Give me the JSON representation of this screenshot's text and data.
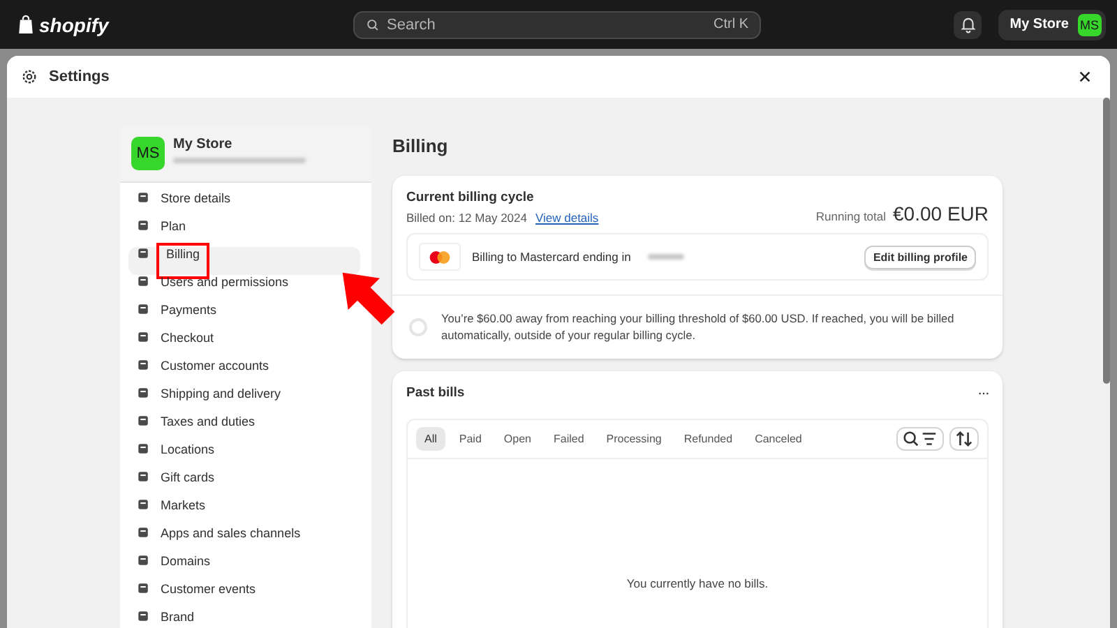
{
  "topbar": {
    "logo": "shopify",
    "search": {
      "placeholder": "Search",
      "shortcut": "Ctrl K"
    },
    "store_button": "My Store",
    "avatar": "MS"
  },
  "settings": {
    "title": "Settings"
  },
  "sidebar": {
    "store": {
      "avatar": "MS",
      "name": "My Store"
    },
    "items": [
      {
        "label": "Store details",
        "selected": false
      },
      {
        "label": "Plan",
        "selected": false
      },
      {
        "label": "Billing",
        "selected": true
      },
      {
        "label": "Users and permissions",
        "selected": false
      },
      {
        "label": "Payments",
        "selected": false
      },
      {
        "label": "Checkout",
        "selected": false
      },
      {
        "label": "Customer accounts",
        "selected": false
      },
      {
        "label": "Shipping and delivery",
        "selected": false
      },
      {
        "label": "Taxes and duties",
        "selected": false
      },
      {
        "label": "Locations",
        "selected": false
      },
      {
        "label": "Gift cards",
        "selected": false
      },
      {
        "label": "Markets",
        "selected": false
      },
      {
        "label": "Apps and sales channels",
        "selected": false
      },
      {
        "label": "Domains",
        "selected": false
      },
      {
        "label": "Customer events",
        "selected": false
      },
      {
        "label": "Brand",
        "selected": false
      }
    ]
  },
  "billing": {
    "title": "Billing",
    "cycle": {
      "title": "Current billing cycle",
      "billed_on": "Billed on: 12 May 2024",
      "link": "View details",
      "running_label": "Running total",
      "running_total": "€0.00 EUR",
      "payment": "Billing to Mastercard ending in",
      "edit_button": "Edit billing profile",
      "threshold": "You’re $60.00 away from reaching your billing threshold of $60.00 USD. If reached, you will be billed automatically, outside of your regular billing cycle."
    },
    "past": {
      "title": "Past bills",
      "more": "···",
      "tabs": [
        {
          "label": "All",
          "selected": true
        },
        {
          "label": "Paid",
          "selected": false
        },
        {
          "label": "Open",
          "selected": false
        },
        {
          "label": "Failed",
          "selected": false
        },
        {
          "label": "Processing",
          "selected": false
        },
        {
          "label": "Refunded",
          "selected": false
        },
        {
          "label": "Canceled",
          "selected": false
        }
      ],
      "empty": "You currently have no bills."
    }
  }
}
